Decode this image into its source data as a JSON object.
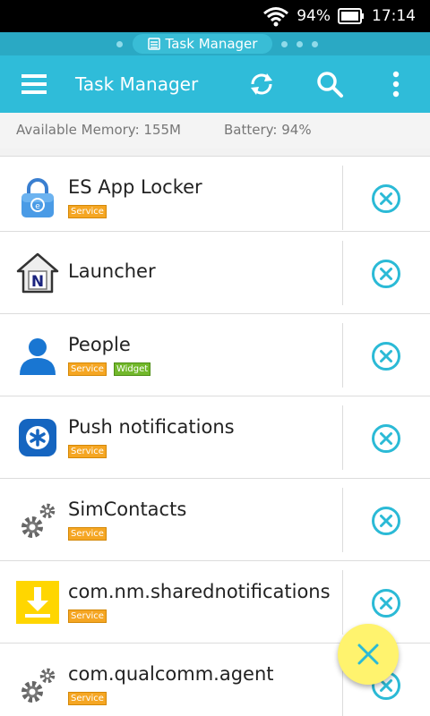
{
  "status_bar": {
    "battery": "94%",
    "time": "17:14"
  },
  "tab_strip": {
    "label": "Task Manager"
  },
  "toolbar": {
    "title": "Task Manager"
  },
  "info": {
    "memory": "Available Memory: 155M",
    "battery": "Battery: 94%"
  },
  "tasks": [
    {
      "name": "ES App Locker",
      "icon": "lock-app-icon",
      "badges": [
        "Service"
      ]
    },
    {
      "name": "Launcher",
      "icon": "launcher-n-icon",
      "badges": []
    },
    {
      "name": "People",
      "icon": "person-icon",
      "badges": [
        "Service",
        "Widget"
      ]
    },
    {
      "name": "Push notifications",
      "icon": "asterisk-icon",
      "badges": [
        "Service"
      ]
    },
    {
      "name": "SimContacts",
      "icon": "gears-icon",
      "badges": [
        "Service"
      ]
    },
    {
      "name": "com.nm.sharednotifications",
      "icon": "download-icon",
      "badges": [
        "Service"
      ]
    },
    {
      "name": "com.qualcomm.agent",
      "icon": "gears-icon",
      "badges": [
        "Service"
      ]
    }
  ],
  "colors": {
    "accent": "#2fbcd9",
    "close": "#2bbad6",
    "fab": "#fff36e",
    "service_badge": "#f5a623",
    "widget_badge": "#72b82b"
  }
}
